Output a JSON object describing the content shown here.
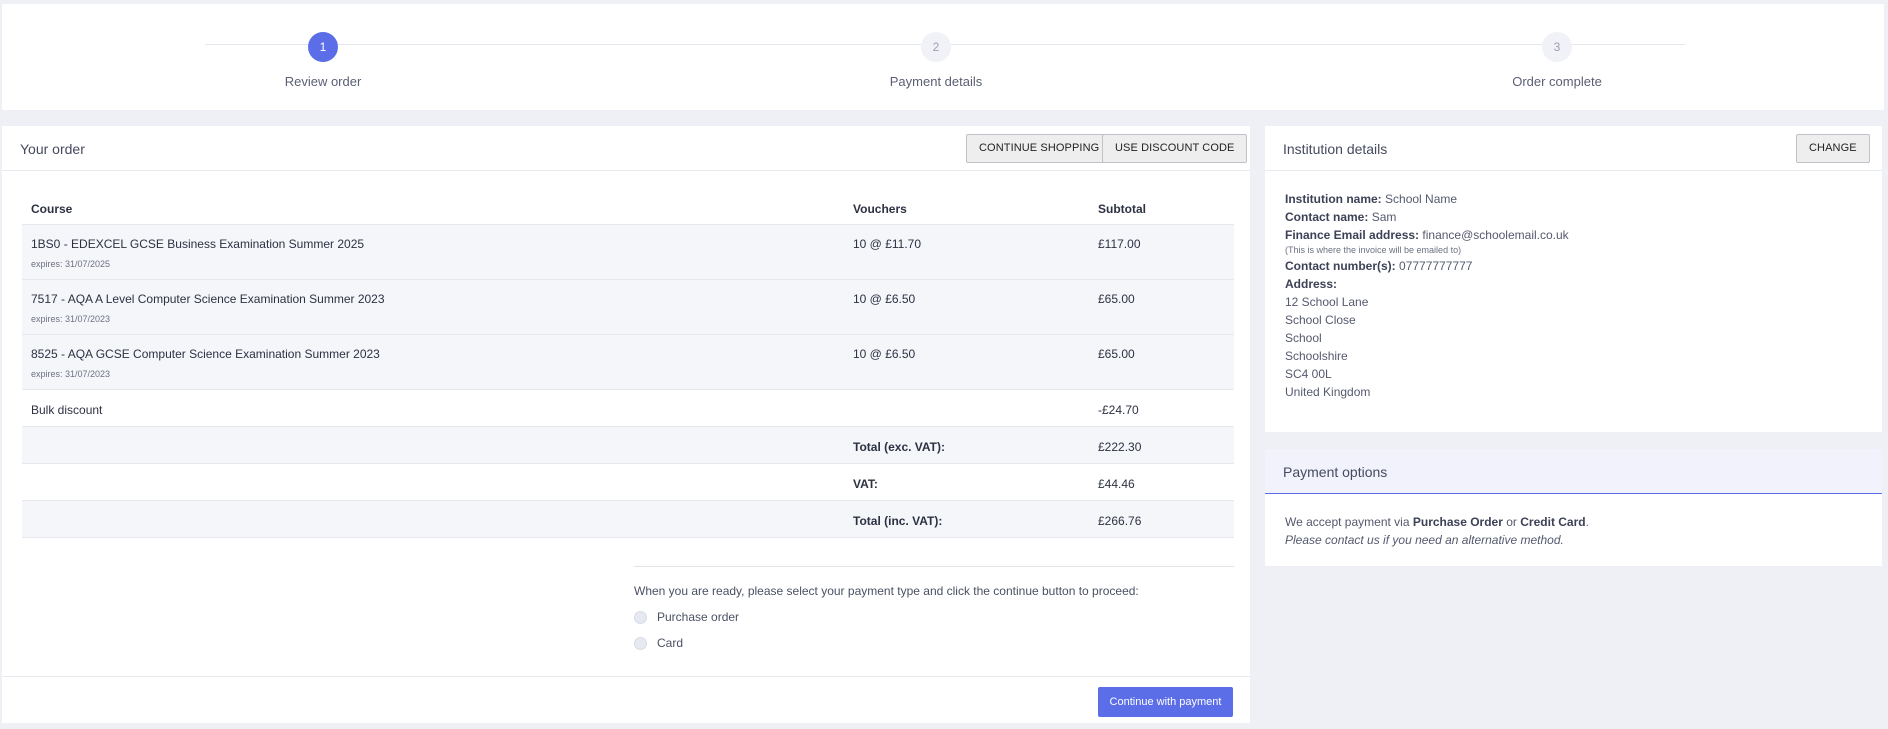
{
  "stepper": {
    "steps": [
      {
        "number": "1",
        "label": "Review order"
      },
      {
        "number": "2",
        "label": "Payment details"
      },
      {
        "number": "3",
        "label": "Order complete"
      }
    ]
  },
  "order": {
    "title": "Your order",
    "continue_shopping": "CONTINUE SHOPPING",
    "use_discount": "USE DISCOUNT CODE",
    "headers": {
      "course": "Course",
      "vouchers": "Vouchers",
      "subtotal": "Subtotal"
    },
    "items": [
      {
        "course": "1BS0 - EDEXCEL GCSE Business Examination Summer 2025",
        "expires": "expires: 31/07/2025",
        "vouchers": "10 @ £11.70",
        "subtotal": "£117.00"
      },
      {
        "course": "7517 - AQA A Level Computer Science Examination Summer 2023",
        "expires": "expires: 31/07/2023",
        "vouchers": "10 @ £6.50",
        "subtotal": "£65.00"
      },
      {
        "course": "8525 - AQA GCSE Computer Science Examination Summer 2023",
        "expires": "expires: 31/07/2023",
        "vouchers": "10 @ £6.50",
        "subtotal": "£65.00"
      }
    ],
    "bulk": {
      "label": "Bulk discount",
      "value": "-£24.70"
    },
    "totals": [
      {
        "label": "Total (exc. VAT):",
        "value": "£222.30"
      },
      {
        "label": "VAT:",
        "value": "£44.46"
      },
      {
        "label": "Total (inc. VAT):",
        "value": "£266.76"
      }
    ],
    "payment_prompt": "When you are ready, please select your payment type and click the continue button to proceed:",
    "payment_types": [
      "Purchase order",
      "Card"
    ],
    "continue_button": "Continue with payment"
  },
  "institution": {
    "title": "Institution details",
    "change": "CHANGE",
    "name_label": "Institution name:",
    "name": "School Name",
    "contact_label": "Contact name:",
    "contact": "Sam",
    "email_label": "Finance Email address:",
    "email": "finance@schoolemail.co.uk",
    "email_note": "(This is where the invoice will be emailed to)",
    "phone_label": "Contact number(s):",
    "phone": "07777777777",
    "address_label": "Address:",
    "address": [
      "12 School Lane",
      "School Close",
      "School",
      "Schoolshire",
      "SC4 00L",
      "United Kingdom"
    ]
  },
  "payment_options": {
    "title": "Payment options",
    "prefix": "We accept payment via",
    "method1": "Purchase Order",
    "or": "or",
    "method2": "Credit Card",
    "period": ".",
    "note": "Please contact us if you need an alternative method."
  },
  "colors": {
    "accent": "#5b6ee8",
    "background": "#eef0f5"
  }
}
